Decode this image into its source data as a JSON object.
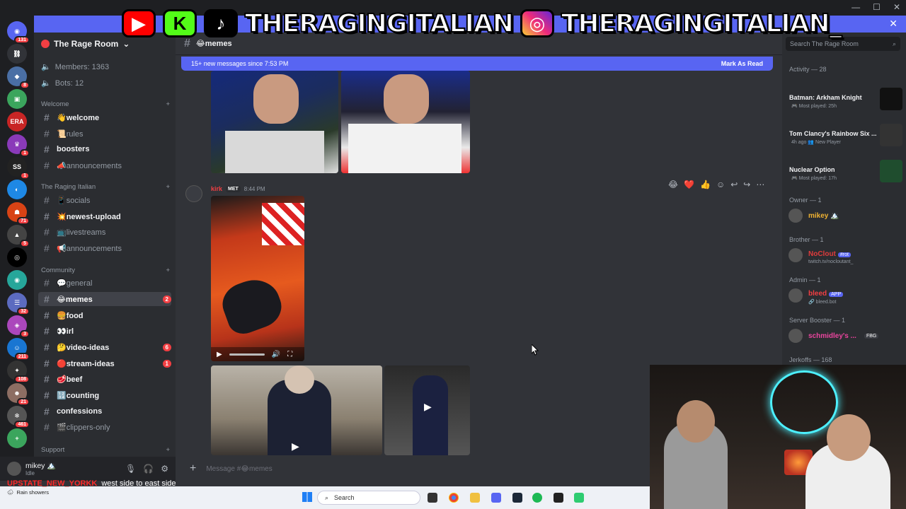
{
  "banner": {
    "logos": [
      "youtube",
      "kick",
      "tiktok",
      "instagram"
    ],
    "handle1": "THERAGINGITALIAN",
    "handle2": "THERAGINGITALIAN_"
  },
  "server": {
    "name": "The Rage Room",
    "members_label": "Members: 1363",
    "bots_label": "Bots: 12"
  },
  "categories": {
    "welcome": "Welcome",
    "raging_italian": "The Raging Italian",
    "community": "Community",
    "support": "Support"
  },
  "channels": [
    {
      "name": "👋welcome",
      "bright": true
    },
    {
      "name": "📜rules",
      "bright": false
    },
    {
      "name": "boosters",
      "bright": true
    },
    {
      "name": "📣announcements",
      "bright": false
    },
    {
      "name": "📱socials",
      "bright": false
    },
    {
      "name": "💥newest-upload",
      "bright": true
    },
    {
      "name": "📺livestreams",
      "bright": false
    },
    {
      "name": "📢announcements",
      "bright": false
    },
    {
      "name": "💬general",
      "bright": false
    },
    {
      "name": "😂memes",
      "bright": true,
      "badge": "2"
    },
    {
      "name": "🍔food",
      "bright": true
    },
    {
      "name": "👀irl",
      "bright": true
    },
    {
      "name": "🤔video-ideas",
      "bright": true,
      "badge": "6"
    },
    {
      "name": "🔴stream-ideas",
      "bright": true,
      "badge": "1"
    },
    {
      "name": "🥩beef",
      "bright": true
    },
    {
      "name": "🔢counting",
      "bright": true
    },
    {
      "name": "confessions",
      "bright": true
    },
    {
      "name": "🎬clippers-only",
      "bright": false
    }
  ],
  "user": {
    "name": "mikey 🏔️",
    "status": "Idle"
  },
  "chat": {
    "channel": "😂memes",
    "new_messages": "15+ new messages since 7:53 PM",
    "mark_as_read": "Mark As Read",
    "author": "kirk",
    "author_tag": "MET",
    "time": "8:44 PM",
    "composer_placeholder": "Message #😂memes"
  },
  "members_panel": {
    "search_placeholder": "Search The Rage Room",
    "activity_header": "Activity — 28",
    "activities": [
      {
        "title": "Batman: Arkham Knight",
        "sub": "🎮 Most played: 25h"
      },
      {
        "title": "Tom Clancy's Rainbow Six ...",
        "sub": "4h ago 👥 New Player"
      },
      {
        "title": "Nuclear Option",
        "sub": "🎮 Most played: 17h"
      }
    ],
    "groups": [
      {
        "header": "Owner — 1",
        "name": "mikey 🏔️",
        "color": "#f0b232",
        "sub": "",
        "tag": ""
      },
      {
        "header": "Brother — 1",
        "name": "NoClout",
        "color": "#e03c3c",
        "sub": "twitch.tv/nocloutant_",
        "tag": "#rot"
      },
      {
        "header": "Admin — 1",
        "name": "bleed",
        "color": "#f23f43",
        "sub": "🔗 bleed.bot",
        "tag": "APP"
      },
      {
        "header": "Server Booster — 1",
        "name": "schmidley's ...",
        "color": "#eb459e",
        "sub": "",
        "tag": "FBG"
      }
    ],
    "jerkoffs_header": "Jerkoffs — 168"
  },
  "caption": {
    "user": "UPSTATE_NEW_YORKK",
    "text": "west side to east side"
  },
  "weather": {
    "temp": "Rain showers"
  },
  "taskbar": {
    "search": "Search"
  },
  "colors": {
    "accent": "#5865f2",
    "unread": "#f23f43"
  }
}
